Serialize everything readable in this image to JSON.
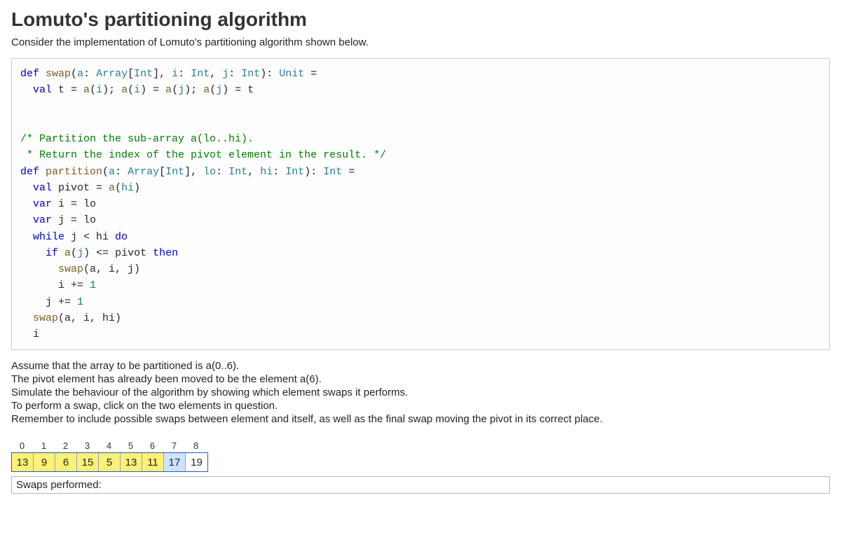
{
  "title": "Lomuto's partitioning algorithm",
  "intro": "Consider the implementation of Lomuto's partitioning algorithm shown below.",
  "code": {
    "l1_def": "def",
    "l1_swap": "swap",
    "l1_open": "(",
    "l1_a": "a",
    "l1_colon1": ": ",
    "l1_arr": "Array",
    "l1_br1": "[",
    "l1_int1": "Int",
    "l1_br2": "], ",
    "l1_i": "i",
    "l1_colon2": ": ",
    "l1_int2": "Int",
    "l1_comma": ", ",
    "l1_j": "j",
    "l1_colon3": ": ",
    "l1_int3": "Int",
    "l1_close": "): ",
    "l1_unit": "Unit",
    "l1_eq": " =",
    "l2_val": "val",
    "l2_t": " t = ",
    "l2_a1": "a",
    "l2_p1": "(",
    "l2_i1": "i",
    "l2_p2": "); ",
    "l2_a2": "a",
    "l2_p3": "(",
    "l2_i2": "i",
    "l2_p4": ") = ",
    "l2_a3": "a",
    "l2_p5": "(",
    "l2_j1": "j",
    "l2_p6": "); ",
    "l2_a4": "a",
    "l2_p7": "(",
    "l2_j2": "j",
    "l2_p8": ") = t",
    "c1": "/* Partition the sub-array a(lo..hi).",
    "c2": " * Return the index of the pivot element in the result. */",
    "l4_def": "def",
    "l4_part": " partition",
    "l4_open": "(",
    "l4_a": "a",
    "l4_colon1": ": ",
    "l4_arr": "Array",
    "l4_br1": "[",
    "l4_int1": "Int",
    "l4_br2": "], ",
    "l4_lo": "lo",
    "l4_colon2": ": ",
    "l4_int2": "Int",
    "l4_comma": ", ",
    "l4_hi": "hi",
    "l4_colon3": ": ",
    "l4_int3": "Int",
    "l4_close": "): ",
    "l4_ret": "Int",
    "l4_eq": " =",
    "l5_val": "val",
    "l5_rest": " pivot = ",
    "l5_a": "a",
    "l5_p1": "(",
    "l5_hi": "hi",
    "l5_p2": ")",
    "l6_var": "var",
    "l6_rest": " i = lo",
    "l7_var": "var",
    "l7_rest": " j = lo",
    "l8_while": "while",
    "l8_cond": " j < hi ",
    "l8_do": "do",
    "l9_if": "if",
    "l9_a": " a",
    "l9_p1": "(",
    "l9_j": "j",
    "l9_p2": ") <= pivot ",
    "l9_then": "then",
    "l10_swap": "swap",
    "l10_args": "(a, i, j)",
    "l11": "i += ",
    "l11_1": "1",
    "l12": "j += ",
    "l12_1": "1",
    "l13_swap": "swap",
    "l13_args": "(a, i, hi)",
    "l14": "i"
  },
  "instructions": {
    "p1": "Assume that the array to be partitioned is a(0..6).",
    "p2": "The pivot element has already been moved to be the element a(6).",
    "p3": "Simulate the behaviour of the algorithm by showing which element swaps it performs.",
    "p4": "To perform a swap, click on the two elements in question.",
    "p5": "Remember to include possible swaps between element and itself, as well as the final swap moving the pivot in its correct place."
  },
  "array": {
    "indices": [
      "0",
      "1",
      "2",
      "3",
      "4",
      "5",
      "6",
      "7",
      "8"
    ],
    "values": [
      "13",
      "9",
      "6",
      "15",
      "5",
      "13",
      "11",
      "17",
      "19"
    ],
    "colors": [
      "yellow",
      "yellow",
      "yellow",
      "yellow",
      "yellow",
      "yellow",
      "yellow",
      "blue",
      "white"
    ]
  },
  "swaps_label": "Swaps performed:"
}
